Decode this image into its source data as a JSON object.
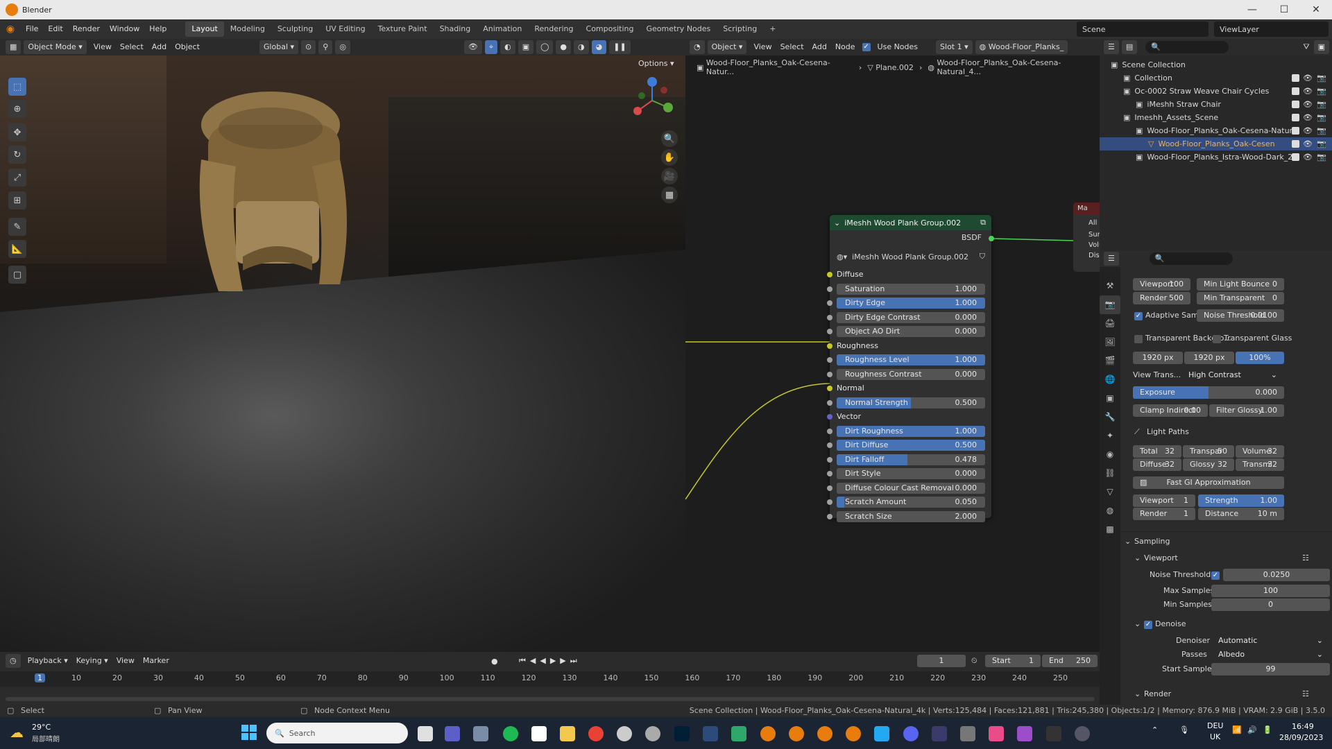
{
  "window": {
    "title": "Blender"
  },
  "menu": [
    "File",
    "Edit",
    "Render",
    "Window",
    "Help"
  ],
  "workspaces": [
    "Layout",
    "Modeling",
    "Sculpting",
    "UV Editing",
    "Texture Paint",
    "Shading",
    "Animation",
    "Rendering",
    "Compositing",
    "Geometry Nodes",
    "Scripting"
  ],
  "active_workspace": "Layout",
  "scene": {
    "scene_name": "Scene",
    "view_layer": "ViewLayer"
  },
  "viewport_header": {
    "mode": "Object Mode",
    "view": "View",
    "select": "Select",
    "add": "Add",
    "object": "Object",
    "transform": "Global",
    "options": "Options"
  },
  "node_header": {
    "object_type": "Object",
    "view": "View",
    "select": "Select",
    "add": "Add",
    "node": "Node",
    "use_nodes": "Use Nodes",
    "slot": "Slot 1",
    "material": "Wood-Floor_Planks_"
  },
  "breadcrumb": [
    "Wood-Floor_Planks_Oak-Cesena-Natur...",
    "Plane.002",
    "Wood-Floor_Planks_Oak-Cesena-Natural_4..."
  ],
  "side_panel": {
    "title": "Ma",
    "all": "All",
    "sockets": [
      "Surfac",
      "Volum",
      "Displa"
    ]
  },
  "node": {
    "title": "iMeshh Wood Plank Group.002",
    "output": "BSDF",
    "group_name": "iMeshh Wood Plank Group.002",
    "inputs": [
      {
        "label": "Diffuse",
        "type": "header"
      },
      {
        "label": "Saturation",
        "value": "1.000",
        "fill": 0
      },
      {
        "label": "Dirty Edge",
        "value": "1.000",
        "fill": 1.0
      },
      {
        "label": "Dirty Edge Contrast",
        "value": "0.000",
        "fill": 0
      },
      {
        "label": "Object AO Dirt",
        "value": "0.000",
        "fill": 0
      },
      {
        "label": "Roughness",
        "type": "header"
      },
      {
        "label": "Roughness Level",
        "value": "1.000",
        "fill": 1.0
      },
      {
        "label": "Roughness Contrast",
        "value": "0.000",
        "fill": 0
      },
      {
        "label": "Normal",
        "type": "header"
      },
      {
        "label": "Normal Strength",
        "value": "0.500",
        "fill": 0.5
      },
      {
        "label": "Vector",
        "type": "header"
      },
      {
        "label": "Dirt Roughness",
        "value": "1.000",
        "fill": 1.0
      },
      {
        "label": "Dirt Diffuse",
        "value": "0.500",
        "fill": 1.0
      },
      {
        "label": "Dirt Falloff",
        "value": "0.478",
        "fill": 0.478
      },
      {
        "label": "Dirt Style",
        "value": "0.000",
        "fill": 0
      },
      {
        "label": "Diffuse Colour Cast Removal",
        "value": "0.000",
        "fill": 0
      },
      {
        "label": "Scratch Amount",
        "value": "0.050",
        "fill": 0.05
      },
      {
        "label": "Scratch Size",
        "value": "2.000",
        "fill": 0
      }
    ]
  },
  "outliner": {
    "rows": [
      {
        "label": "Scene Collection",
        "indent": 0
      },
      {
        "label": "Collection",
        "indent": 1
      },
      {
        "label": "Oc-0002 Straw Weave Chair Cycles",
        "indent": 1
      },
      {
        "label": "iMeshh Straw Chair",
        "indent": 2
      },
      {
        "label": "Imeshh_Assets_Scene",
        "indent": 1
      },
      {
        "label": "Wood-Floor_Planks_Oak-Cesena-Natura",
        "indent": 2
      },
      {
        "label": "Wood-Floor_Planks_Oak-Cesen",
        "indent": 3,
        "selected": true
      },
      {
        "label": "Wood-Floor_Planks_Istra-Wood-Dark_2K",
        "indent": 2
      }
    ]
  },
  "properties": {
    "viewport_samples": {
      "label": "Viewport",
      "value": "100"
    },
    "render_samples": {
      "label": "Render",
      "value": "500"
    },
    "min_light_bounce": {
      "label": "Min Light Bounce",
      "value": "0"
    },
    "min_transparent_bounce": {
      "label": "Min Transparent Bounc",
      "value": "0"
    },
    "adaptive_sampling": "Adaptive Sam...",
    "noise_threshold": {
      "label": "Noise Threshold",
      "value": "0.0100"
    },
    "transparent_background": "Transparent Backgro...",
    "transparent_glass": "Transparent Glass",
    "res_x": "1920 px",
    "res_y": "1920 px",
    "res_pct": "100%",
    "view_transform": {
      "label": "View Trans...",
      "value": "High Contrast"
    },
    "exposure": {
      "label": "Exposure",
      "value": "0.000"
    },
    "clamp_indirect": {
      "label": "Clamp Indirect",
      "value": "0.00"
    },
    "filter_glossy": {
      "label": "Filter Glossy",
      "value": "1.00"
    },
    "light_paths": "Light Paths",
    "lp_total": {
      "label": "Total",
      "value": "32"
    },
    "lp_transparent": {
      "label": "Transpar",
      "value": "50"
    },
    "lp_volume": {
      "label": "Volume",
      "value": "32"
    },
    "lp_diffuse": {
      "label": "Diffuse",
      "value": "32"
    },
    "lp_glossy": {
      "label": "Glossy",
      "value": "32"
    },
    "lp_transmission": {
      "label": "Transmi",
      "value": "32"
    },
    "fast_gi": "Fast GI Approximation",
    "gi_viewport": {
      "label": "Viewport",
      "value": "1"
    },
    "gi_strength": {
      "label": "Strength",
      "value": "1.00"
    },
    "gi_render": {
      "label": "Render",
      "value": "1"
    },
    "gi_distance": {
      "label": "Distance",
      "value": "10 m"
    },
    "sampling": "Sampling",
    "viewport_section": "Viewport",
    "vp_noise_threshold": {
      "label": "Noise Threshold",
      "value": "0.0250"
    },
    "vp_max_samples": {
      "label": "Max Samples",
      "value": "100"
    },
    "vp_min_samples": {
      "label": "Min Samples",
      "value": "0"
    },
    "denoise": "Denoise",
    "denoiser": {
      "label": "Denoiser",
      "value": "Automatic"
    },
    "passes": {
      "label": "Passes",
      "value": "Albedo"
    },
    "start_sample": {
      "label": "Start Sample",
      "value": "99"
    },
    "render_section": "Render"
  },
  "timeline": {
    "playback": "Playback",
    "keying": "Keying",
    "view": "View",
    "marker": "Marker",
    "current_frame": "1",
    "start_label": "Start",
    "start": "1",
    "end_label": "End",
    "end": "250",
    "ticks": [
      "1",
      "10",
      "20",
      "30",
      "40",
      "50",
      "60",
      "70",
      "80",
      "90",
      "100",
      "110",
      "120",
      "130",
      "140",
      "150",
      "160",
      "170",
      "180",
      "190",
      "200",
      "210",
      "220",
      "230",
      "240",
      "250"
    ]
  },
  "statusbar": {
    "select": "Select",
    "pan_view": "Pan View",
    "node_context": "Node Context Menu",
    "info": "Scene Collection | Wood-Floor_Planks_Oak-Cesena-Natural_4k | Verts:125,484 | Faces:121,881 | Tris:245,380 | Objects:1/2 | Memory: 876.9 MiB | VRAM: 2.9 GiB | 3.5.0"
  },
  "taskbar": {
    "weather_temp": "29°C",
    "weather_desc": "局部晴朗",
    "search": "Search",
    "lang": "DEU",
    "region": "UK",
    "time": "16:49",
    "date": "28/09/2023"
  },
  "colors": {
    "accent": "#4772b3",
    "node_header": "#1f4a32",
    "socket_yellow": "#c7c729",
    "socket_purple": "#6363c7",
    "socket_green": "#4cd15a"
  }
}
